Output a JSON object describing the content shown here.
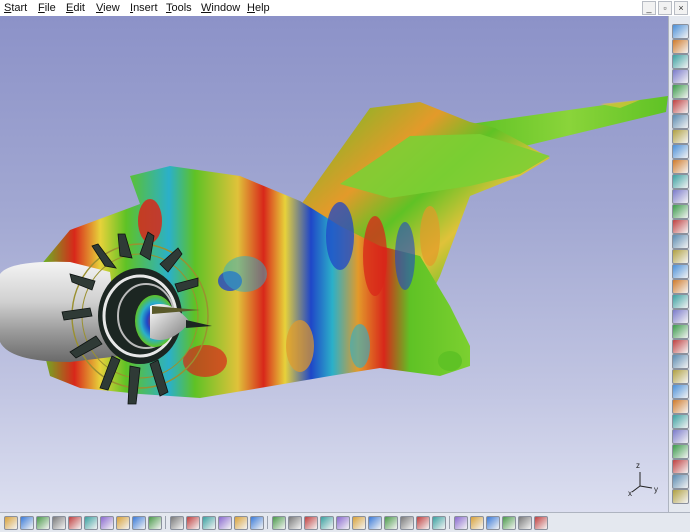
{
  "menubar": {
    "items": [
      {
        "label": "Start",
        "mnemonic": "S",
        "rest": "tart"
      },
      {
        "label": "File",
        "mnemonic": "F",
        "rest": "ile"
      },
      {
        "label": "Edit",
        "mnemonic": "E",
        "rest": "dit"
      },
      {
        "label": "View",
        "mnemonic": "V",
        "rest": "iew"
      },
      {
        "label": "Insert",
        "mnemonic": "I",
        "rest": "nsert"
      },
      {
        "label": "Tools",
        "mnemonic": "T",
        "rest": "ools"
      },
      {
        "label": "Window",
        "mnemonic": "W",
        "rest": "indow"
      },
      {
        "label": "Help",
        "mnemonic": "H",
        "rest": "elp"
      }
    ],
    "window_controls": [
      "_",
      "▫",
      "×"
    ]
  },
  "viewport": {
    "axis_labels": {
      "x": "x",
      "y": "y",
      "z": "z"
    },
    "colors": {
      "background_top": "#8c92c8",
      "background_bottom": "#dcdff0",
      "contour_high": "#d8271a",
      "contour_mid": "#5fc225",
      "contour_low": "#1f46c8"
    }
  },
  "toolbars": {
    "right_icons": [
      "audio-icon",
      "select-icon",
      "pan-icon",
      "rotate-icon",
      "zoom-icon",
      "fit-icon",
      "normal-view-icon",
      "hide-icon",
      "swap-icon",
      "view-mode-icon",
      "render-icon",
      "material-icon",
      "measure-icon",
      "analysis-icon",
      "sketch-icon",
      "pad-icon",
      "pocket-icon",
      "shaft-icon",
      "groove-icon",
      "hole-icon",
      "fillet-icon",
      "chamfer-icon",
      "draft-icon",
      "shell-icon",
      "thickness-icon",
      "split-icon",
      "pattern-icon",
      "mirror-icon",
      "scale-icon",
      "boolean-icon",
      "constraint-icon",
      "annotation-icon"
    ],
    "bottom_icons": [
      "new-icon",
      "open-icon",
      "save-icon",
      "print-icon",
      "cut-icon",
      "copy-icon",
      "paste-icon",
      "undo-icon",
      "redo-icon",
      "whats-this-icon",
      "formula-icon",
      "comment-icon",
      "catalog-icon",
      "table-icon",
      "knowledge-icon",
      "fly-icon",
      "fit-all-icon",
      "pan-icon",
      "rotate-icon",
      "zoom-in-icon",
      "zoom-out-icon",
      "normal-view-icon",
      "multi-view-icon",
      "iso-view-icon",
      "shading-icon",
      "hide-show-icon",
      "swap-space-icon",
      "snap-icon",
      "grid-icon",
      "plane-icon",
      "axis-icon",
      "analysis-icon",
      "measure-icon"
    ]
  }
}
